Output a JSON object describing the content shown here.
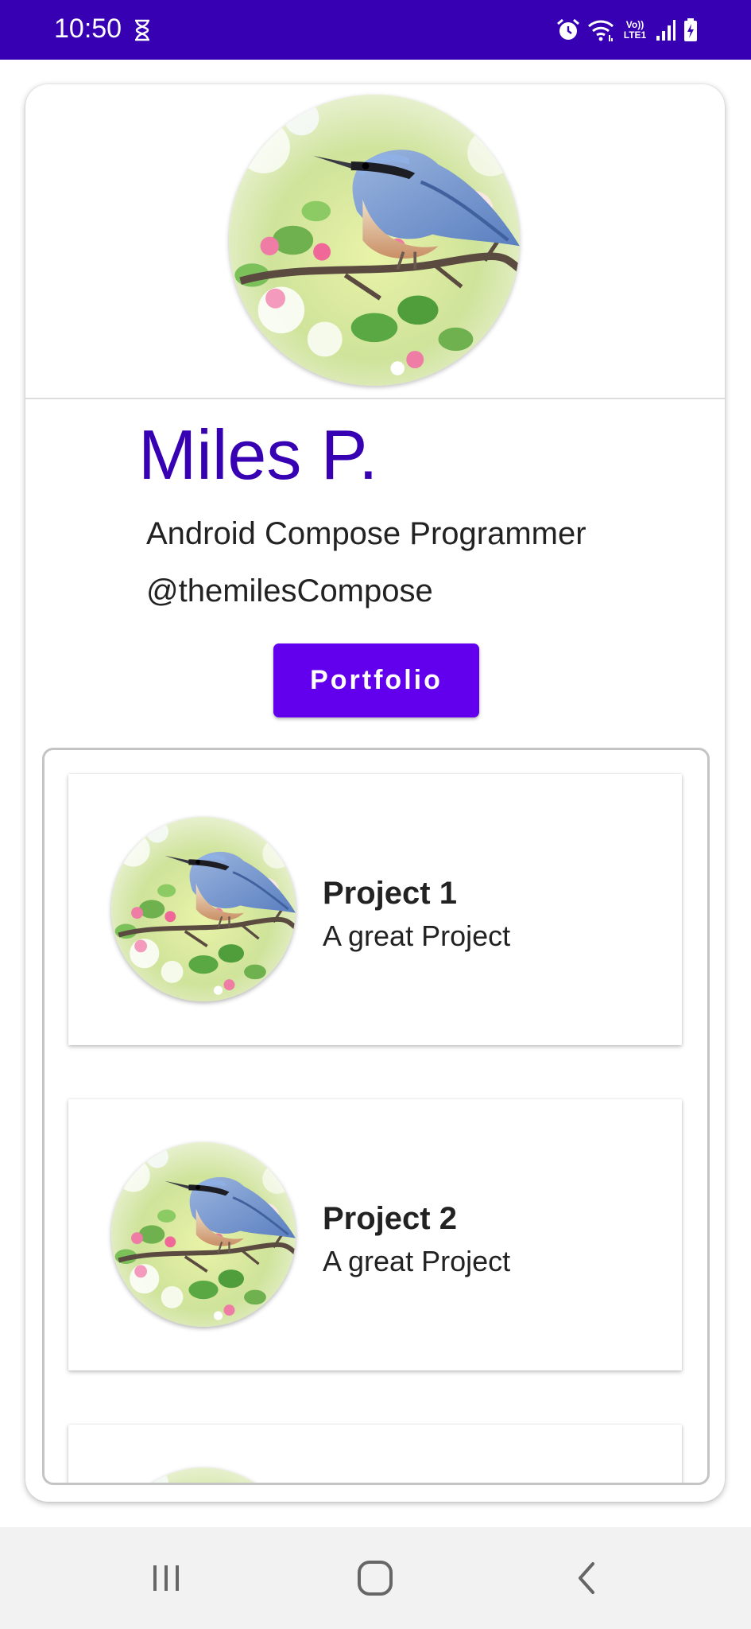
{
  "status_bar": {
    "time": "10:50",
    "network_label": "Vo)) LTE1",
    "icons": [
      "hourglass-icon",
      "alarm-icon",
      "wifi-icon",
      "signal-icon",
      "battery-charging-icon"
    ]
  },
  "profile": {
    "avatar": "bird-photo",
    "name": "Miles P.",
    "role": "Android Compose Programmer",
    "handle": "@themilesCompose",
    "portfolio_label": "Portfolio"
  },
  "projects": [
    {
      "title": "Project 1",
      "description": "A great Project"
    },
    {
      "title": "Project 2",
      "description": "A great Project"
    }
  ],
  "nav_bar": {
    "icons": [
      "recent-apps-icon",
      "home-icon",
      "back-icon"
    ]
  },
  "colors": {
    "status_bar": "#3700b3",
    "name": "#3700b3",
    "button": "#6200ee"
  }
}
